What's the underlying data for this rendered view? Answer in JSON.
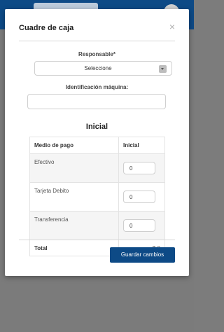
{
  "modal": {
    "title": "Cuadre de caja",
    "close_symbol": "×",
    "responsable_label": "Responsable*",
    "responsable_select": {
      "selected": "Seleccione"
    },
    "machine_label": "Identificación máquina:",
    "machine_input": {
      "value": "",
      "placeholder": ""
    },
    "section_title": "Inicial",
    "table": {
      "headers": [
        "Medio de pago",
        "Inicial"
      ],
      "rows": [
        {
          "method": "Efectivo",
          "value": "0"
        },
        {
          "method": "Tarjeta Debito",
          "value": "0"
        },
        {
          "method": "Transferencia",
          "value": "0"
        }
      ],
      "total_label": "Total",
      "total_value": "$ 0"
    },
    "save_button": "Guardar cambios"
  },
  "colors": {
    "primary": "#0d4a86",
    "overlay": "#7b7b7b"
  },
  "icons": {
    "close": "close-icon",
    "dropdown": "chevron-down-icon"
  }
}
